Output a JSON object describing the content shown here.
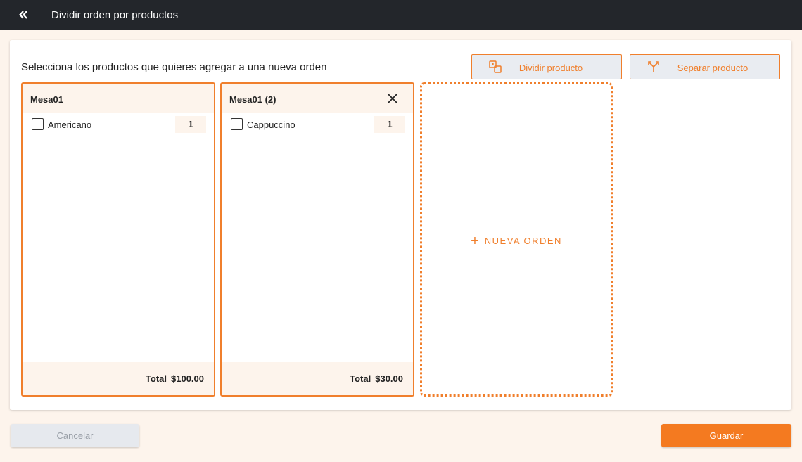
{
  "header": {
    "title": "Dividir orden por productos",
    "back_icon": "double-chevron-left-icon"
  },
  "main": {
    "instruction": "Selecciona los productos que quieres agregar a una nueva orden",
    "actions": {
      "dividir_label": "Dividir producto",
      "separar_label": "Separar producto"
    },
    "orders": [
      {
        "title": "Mesa01",
        "closable": false,
        "items": [
          {
            "name": "Americano",
            "qty": "1",
            "checked": false
          }
        ],
        "total_label": "Total",
        "total_value": "$100.00"
      },
      {
        "title": "Mesa01 (2)",
        "closable": true,
        "items": [
          {
            "name": "Cappuccino",
            "qty": "1",
            "checked": false
          }
        ],
        "total_label": "Total",
        "total_value": "$30.00"
      }
    ],
    "new_order_label": "NUEVA ORDEN"
  },
  "footer": {
    "cancel_label": "Cancelar",
    "save_label": "Guardar"
  },
  "colors": {
    "accent": "#f07f2c",
    "topbar": "#23262b",
    "background": "#fdf4ec"
  }
}
